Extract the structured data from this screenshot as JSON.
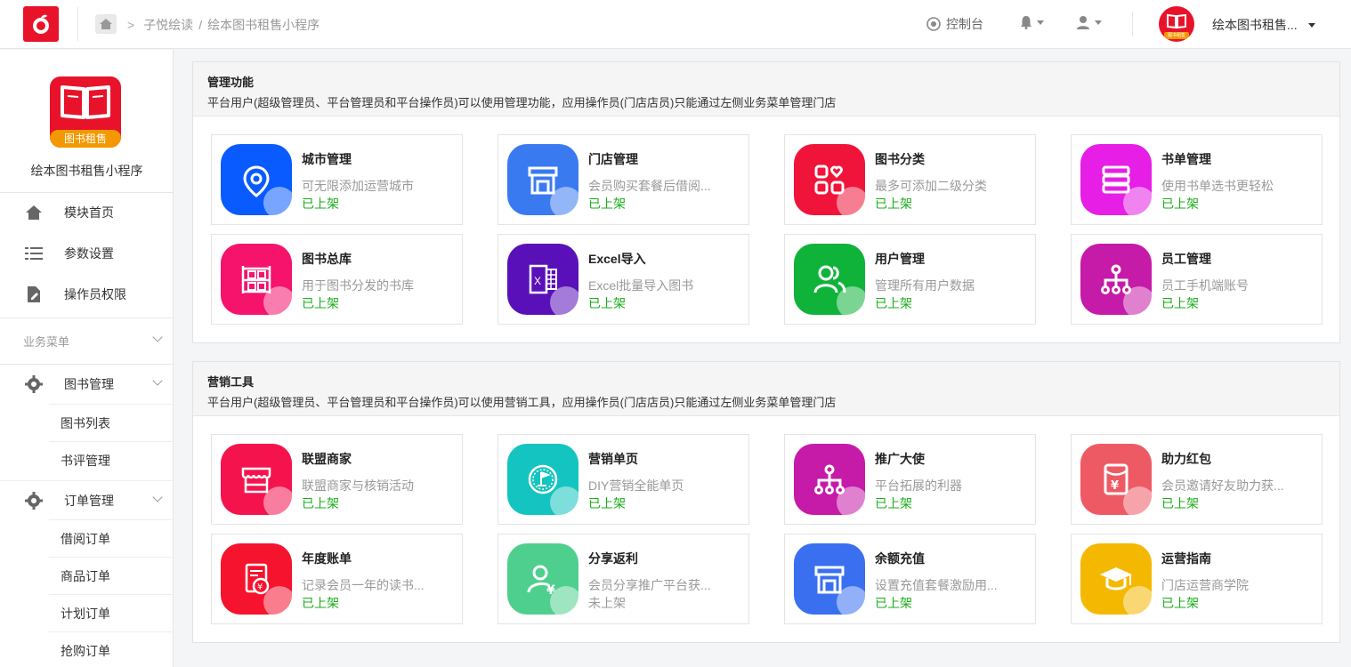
{
  "header": {
    "breadcrumb": [
      "子悦绘读",
      "/",
      "绘本图书租售小程序"
    ],
    "console_label": "控制台",
    "app_name": "绘本图书租售...",
    "avatar_tag": "图书租售"
  },
  "sidebar": {
    "logo_tag": "图书租售",
    "app_name": "绘本图书租售小程序",
    "top_items": [
      {
        "label": "模块首页",
        "icon": "home-icon"
      },
      {
        "label": "参数设置",
        "icon": "list-settings-icon"
      },
      {
        "label": "操作员权限",
        "icon": "document-edit-icon"
      }
    ],
    "group_label": "业务菜单",
    "book_menu": {
      "label": "图书管理",
      "children": [
        "图书列表",
        "书评管理"
      ]
    },
    "order_menu": {
      "label": "订单管理",
      "children": [
        "借阅订单",
        "商品订单",
        "计划订单",
        "抢购订单"
      ]
    }
  },
  "panels": [
    {
      "title": "管理功能",
      "desc": "平台用户(超级管理员、平台管理员和平台操作员)可以使用管理功能，应用操作员(门店店员)只能通过左侧业务菜单管理门店",
      "cards": [
        {
          "name": "城市管理",
          "desc": "可无限添加运营城市",
          "status": "已上架",
          "color": "#0a5bff",
          "icon": "location-pin-icon"
        },
        {
          "name": "门店管理",
          "desc": "会员购买套餐后借阅...",
          "status": "已上架",
          "color": "#3a7af0",
          "icon": "store-icon"
        },
        {
          "name": "图书分类",
          "desc": "最多可添加二级分类",
          "status": "已上架",
          "color": "#f0143a",
          "icon": "category-grid-icon"
        },
        {
          "name": "书单管理",
          "desc": "使用书单选书更轻松",
          "status": "已上架",
          "color": "#e61ee6",
          "icon": "book-stack-icon"
        },
        {
          "name": "图书总库",
          "desc": "用于图书分发的书库",
          "status": "已上架",
          "color": "#f5136c",
          "icon": "bookshelf-icon"
        },
        {
          "name": "Excel导入",
          "desc": "Excel批量导入图书",
          "status": "已上架",
          "color": "#5a10b8",
          "icon": "excel-icon"
        },
        {
          "name": "用户管理",
          "desc": "管理所有用户数据",
          "status": "已上架",
          "color": "#0fb33a",
          "icon": "users-icon"
        },
        {
          "name": "员工管理",
          "desc": "员工手机端账号",
          "status": "已上架",
          "color": "#c61aa8",
          "icon": "org-tree-icon"
        }
      ]
    },
    {
      "title": "营销工具",
      "desc": "平台用户(超级管理员、平台管理员和平台操作员)可以使用营销工具，应用操作员(门店店员)只能通过左侧业务菜单管理门店",
      "cards": [
        {
          "name": "联盟商家",
          "desc": "联盟商家与核销活动",
          "status": "已上架",
          "color": "#f5134e",
          "icon": "shop-awning-icon"
        },
        {
          "name": "营销单页",
          "desc": "DIY营销全能单页",
          "status": "已上架",
          "color": "#14c4c0",
          "icon": "flag-badge-icon"
        },
        {
          "name": "推广大使",
          "desc": "平台拓展的利器",
          "status": "已上架",
          "color": "#c61aa8",
          "icon": "org-tree-icon"
        },
        {
          "name": "助力红包",
          "desc": "会员邀请好友助力获...",
          "status": "已上架",
          "color": "#ee5a63",
          "icon": "red-packet-icon"
        },
        {
          "name": "年度账单",
          "desc": "记录会员一年的读书...",
          "status": "已上架",
          "color": "#f5132e",
          "icon": "bill-icon"
        },
        {
          "name": "分享返利",
          "desc": "会员分享推广平台获...",
          "status": "未上架",
          "color": "#4fcf8e",
          "icon": "user-yuan-icon"
        },
        {
          "name": "余额充值",
          "desc": "设置充值套餐激励用...",
          "status": "已上架",
          "color": "#3a6ff0",
          "icon": "store-icon"
        },
        {
          "name": "运营指南",
          "desc": "门店运营商学院",
          "status": "已上架",
          "color": "#f5b800",
          "icon": "graduation-cap-icon"
        }
      ]
    }
  ]
}
